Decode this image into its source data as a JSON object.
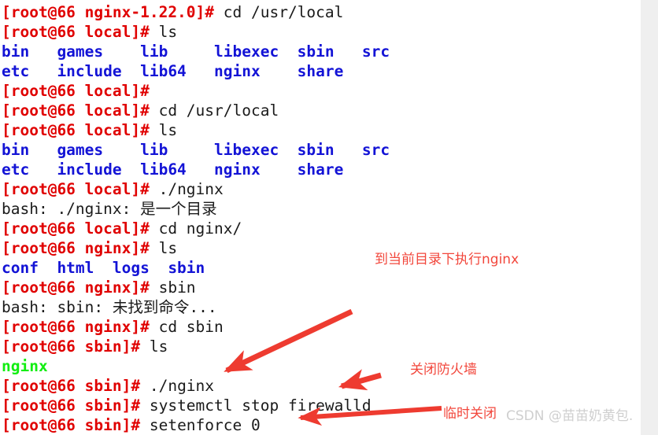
{
  "terminal": {
    "lines": [
      {
        "prompt": "[root@66 nginx-1.22.0]#",
        "command": " cd /usr/local"
      },
      {
        "prompt": "[root@66 local]#",
        "command": " ls"
      },
      {
        "listing": "bin   games    lib     libexec  sbin   src",
        "kind": "dir"
      },
      {
        "listing": "etc   include  lib64   nginx    share",
        "kind": "dir"
      },
      {
        "prompt": "[root@66 local]#",
        "command": ""
      },
      {
        "prompt": "[root@66 local]#",
        "command": " cd /usr/local"
      },
      {
        "prompt": "[root@66 local]#",
        "command": " ls"
      },
      {
        "listing": "bin   games    lib     libexec  sbin   src",
        "kind": "dir"
      },
      {
        "listing": "etc   include  lib64   nginx    share",
        "kind": "dir"
      },
      {
        "prompt": "[root@66 local]#",
        "command": " ./nginx"
      },
      {
        "message": "bash: ./nginx: 是一个目录"
      },
      {
        "prompt": "[root@66 local]#",
        "command": " cd nginx/"
      },
      {
        "prompt": "[root@66 nginx]#",
        "command": " ls"
      },
      {
        "listing": "conf  html  logs  sbin",
        "kind": "dir"
      },
      {
        "prompt": "[root@66 nginx]#",
        "command": " sbin"
      },
      {
        "message": "bash: sbin: 未找到命令..."
      },
      {
        "prompt": "[root@66 nginx]#",
        "command": " cd sbin"
      },
      {
        "prompt": "[root@66 sbin]#",
        "command": " ls"
      },
      {
        "listing": "nginx",
        "kind": "exe"
      },
      {
        "prompt": "[root@66 sbin]#",
        "command": " ./nginx"
      },
      {
        "prompt": "[root@66 sbin]#",
        "command": " systemctl stop firewalld"
      },
      {
        "prompt": "[root@66 sbin]#",
        "command": " setenforce 0"
      }
    ]
  },
  "annotations": {
    "exec_nginx": "到当前目录下执行nginx",
    "close_firewall": "关闭防火墙",
    "temp_close": "临时关闭"
  },
  "watermark": {
    "text": "CSDN @苗苗奶黄包."
  },
  "colors": {
    "prompt_red": "#e00000",
    "dir_blue": "#1313d6",
    "exe_green": "#11ee11",
    "annotation_red": "#f2473c",
    "watermark_gray": "#cfcfcf",
    "gutter_gray": "#efefef",
    "background": "#ffffff"
  }
}
